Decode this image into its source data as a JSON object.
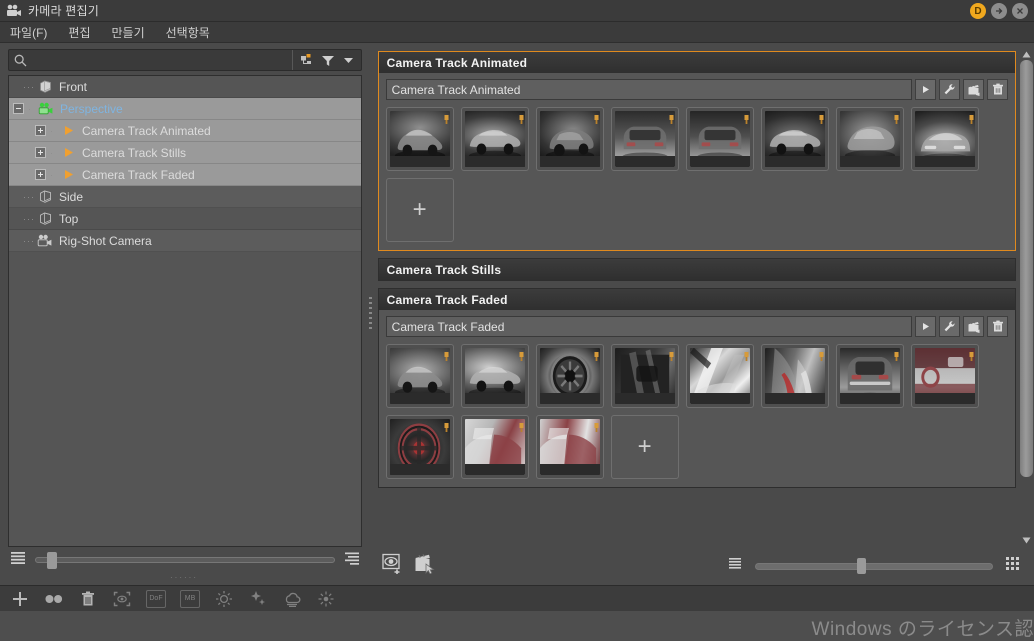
{
  "window": {
    "title": "카메라 편집기",
    "icon": "camera-icon",
    "buttons": [
      {
        "name": "license-badge-button",
        "label": "D",
        "color": "#f0a81e"
      },
      {
        "name": "minimize-to-side-button",
        "label": "",
        "color": "#8d8d8d"
      },
      {
        "name": "close-button",
        "label": "",
        "color": "#8d8d8d"
      }
    ]
  },
  "menubar": {
    "items": [
      {
        "name": "menu-file",
        "label": "파일(F)"
      },
      {
        "name": "menu-edit",
        "label": "편집"
      },
      {
        "name": "menu-create",
        "label": "만들기"
      },
      {
        "name": "menu-selection",
        "label": "선택항목"
      }
    ]
  },
  "left_panel": {
    "search": {
      "value": "",
      "placeholder": ""
    },
    "search_tools": [
      {
        "name": "hierarchy-filter-icon"
      },
      {
        "name": "funnel-filter-icon"
      },
      {
        "name": "chevron-down-icon"
      }
    ],
    "tree": [
      {
        "label": "Front",
        "icon": "cube-view-icon",
        "depth": 1,
        "toggle": "none",
        "selected": false,
        "highlight": false
      },
      {
        "label": "Perspective",
        "icon": "camera-green-icon",
        "depth": 0,
        "toggle": "minus",
        "selected": true,
        "highlight": true
      },
      {
        "label": "Camera Track Animated",
        "icon": "play-orange-icon",
        "depth": 2,
        "toggle": "plus",
        "selected": true,
        "highlight": false
      },
      {
        "label": "Camera Track Stills",
        "icon": "play-orange-icon",
        "depth": 2,
        "toggle": "plus",
        "selected": true,
        "highlight": false
      },
      {
        "label": "Camera Track Faded",
        "icon": "play-orange-icon",
        "depth": 2,
        "toggle": "plus",
        "selected": true,
        "highlight": false
      },
      {
        "label": "Side",
        "icon": "cube-view-icon",
        "depth": 1,
        "toggle": "none",
        "selected": false,
        "highlight": false
      },
      {
        "label": "Top",
        "icon": "cube-view-icon",
        "depth": 1,
        "toggle": "none",
        "selected": false,
        "highlight": false
      },
      {
        "label": "Rig-Shot Camera",
        "icon": "camera-gray-icon",
        "depth": 1,
        "toggle": "none",
        "selected": false,
        "highlight": false
      }
    ],
    "bottom": {
      "list_icon": "list-lines-icon",
      "slider_value": 4,
      "align_icon": "align-right-lines-icon"
    }
  },
  "tracks": [
    {
      "name": "track-animated",
      "header": "Camera Track Animated",
      "selected": true,
      "collapsed": false,
      "name_value": "Camera Track Animated",
      "buttons": [
        {
          "name": "play-track-button",
          "icon": "play-icon"
        },
        {
          "name": "settings-wrench-button",
          "icon": "wrench-icon"
        },
        {
          "name": "render-clapper-button",
          "icon": "clapperboard-icon"
        },
        {
          "name": "delete-track-button",
          "icon": "trash-icon"
        }
      ],
      "shots": [
        {
          "name": "shot-1",
          "style": "car-3q-front-left"
        },
        {
          "name": "shot-2",
          "style": "car-side-high"
        },
        {
          "name": "shot-3",
          "style": "car-rear-3q"
        },
        {
          "name": "shot-4",
          "style": "car-rear"
        },
        {
          "name": "shot-5",
          "style": "car-rear-low"
        },
        {
          "name": "shot-6",
          "style": "car-side-dark"
        },
        {
          "name": "shot-7",
          "style": "car-top-3q"
        },
        {
          "name": "shot-8",
          "style": "car-front"
        }
      ],
      "add_label": "+"
    },
    {
      "name": "track-stills",
      "header": "Camera Track Stills",
      "selected": false,
      "collapsed": true,
      "name_value": "Camera Track Stills",
      "buttons": [],
      "shots": [],
      "add_label": "+"
    },
    {
      "name": "track-faded",
      "header": "Camera Track Faded",
      "selected": false,
      "collapsed": false,
      "name_value": "Camera Track Faded",
      "buttons": [
        {
          "name": "play-track-button",
          "icon": "play-icon"
        },
        {
          "name": "settings-wrench-button",
          "icon": "wrench-icon"
        },
        {
          "name": "render-clapper-button",
          "icon": "clapperboard-icon"
        },
        {
          "name": "delete-track-button",
          "icon": "trash-icon"
        }
      ],
      "shots": [
        {
          "name": "shot-1",
          "style": "car-3q-silver"
        },
        {
          "name": "shot-2",
          "style": "car-hood-silver"
        },
        {
          "name": "shot-3",
          "style": "wheel-detail"
        },
        {
          "name": "shot-4",
          "style": "grille-detail"
        },
        {
          "name": "shot-5",
          "style": "mirror-detail"
        },
        {
          "name": "shot-6",
          "style": "taillight-detail"
        },
        {
          "name": "shot-7",
          "style": "trunk-rear"
        },
        {
          "name": "shot-8",
          "style": "interior-dash"
        },
        {
          "name": "shot-9",
          "style": "interior-wheel"
        },
        {
          "name": "shot-10",
          "style": "interior-seat"
        },
        {
          "name": "shot-11",
          "style": "interior-rear-seat"
        }
      ],
      "add_label": "+"
    }
  ],
  "right_bottom": {
    "tools": [
      {
        "name": "add-view-button",
        "icon": "eye-plus-icon"
      },
      {
        "name": "add-shot-button",
        "icon": "clapper-cursor-icon"
      }
    ],
    "view_list_icon": "list-view-icon",
    "zoom_value": 43,
    "view_grid_icon": "grid-view-icon"
  },
  "statusbar": {
    "items": [
      {
        "name": "add-camera-button",
        "icon": "plus-icon",
        "label": ""
      },
      {
        "name": "two-dots-button",
        "icon": "two-dots-icon",
        "label": ""
      },
      {
        "name": "delete-button",
        "icon": "trash-icon",
        "label": ""
      },
      {
        "name": "focus-target-button",
        "icon": "focus-bracket-icon",
        "label": ""
      },
      {
        "name": "depth-of-field-button",
        "icon": "badge",
        "label": "DoF"
      },
      {
        "name": "motion-blur-button",
        "icon": "badge",
        "label": "MB"
      },
      {
        "name": "exposure-button",
        "icon": "sun-icon",
        "label": ""
      },
      {
        "name": "glare-button",
        "icon": "sparkle-icon",
        "label": ""
      },
      {
        "name": "fog-button",
        "icon": "cloud-icon",
        "label": ""
      },
      {
        "name": "bloom-button",
        "icon": "small-sun-icon",
        "label": ""
      }
    ]
  },
  "footer": {
    "watermark": "Windows のライセンス認"
  }
}
